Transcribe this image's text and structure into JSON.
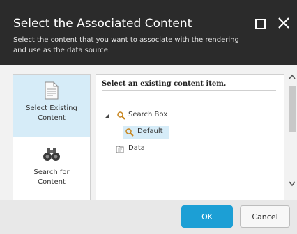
{
  "dialog": {
    "title": "Select the Associated Content",
    "subtitle": "Select the content that you want to associate with the rendering and use as the data source."
  },
  "modes": [
    {
      "label": "Select Existing Content",
      "icon": "document-icon",
      "selected": true
    },
    {
      "label": "Search for Content",
      "icon": "binoculars-icon",
      "selected": false
    }
  ],
  "tree": {
    "header": "Select an existing content item.",
    "items": [
      {
        "label": "Search Box",
        "icon": "search-icon",
        "expanded": true
      },
      {
        "label": "Default",
        "icon": "search-icon",
        "selected": true
      },
      {
        "label": "Data",
        "icon": "folder-data-icon"
      }
    ]
  },
  "buttons": {
    "ok": "OK",
    "cancel": "Cancel"
  },
  "colors": {
    "header_bg": "#2b2b2b",
    "accent": "#1c9fd5",
    "selection": "#d6ecf8"
  }
}
